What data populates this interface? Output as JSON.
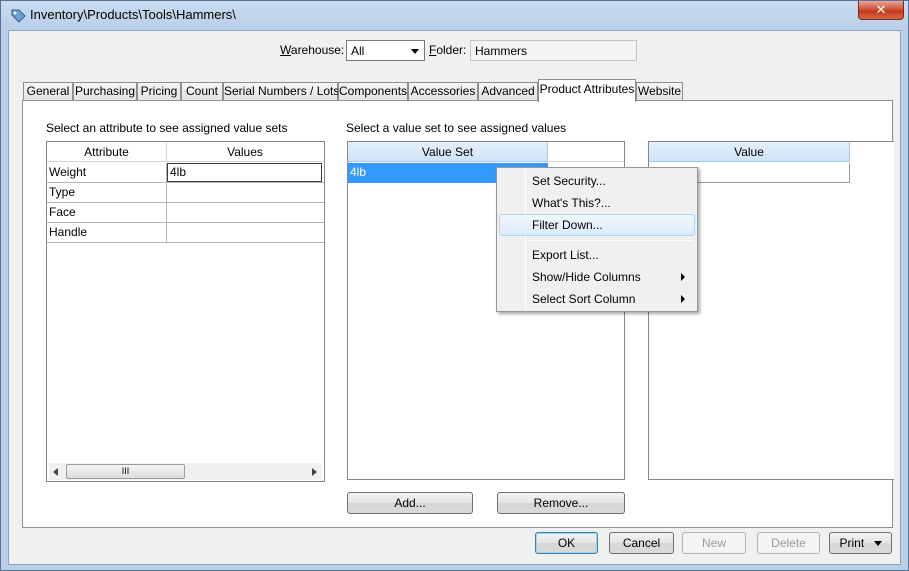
{
  "window": {
    "title": "Inventory\\Products\\Tools\\Hammers\\",
    "close_label": "✕"
  },
  "header": {
    "warehouse_label": "Warehouse:",
    "warehouse_value": "All",
    "folder_label": "Folder:",
    "folder_value": "Hammers"
  },
  "tabs": [
    "General",
    "Purchasing",
    "Pricing",
    "Count",
    "Serial Numbers / Lots",
    "Components",
    "Accessories",
    "Advanced",
    "Product Attributes",
    "Website"
  ],
  "active_tab": "Product Attributes",
  "attributes": {
    "instruction": "Select an attribute to see assigned value sets",
    "columns": [
      "Attribute",
      "Values"
    ],
    "rows": [
      {
        "attribute": "Weight",
        "values": "4lb"
      },
      {
        "attribute": "Type",
        "values": ""
      },
      {
        "attribute": "Face",
        "values": ""
      },
      {
        "attribute": "Handle",
        "values": ""
      }
    ],
    "scroll_grip": "III"
  },
  "value_sets": {
    "instruction": "Select a value set to see assigned values",
    "column": "Value Set",
    "rows": [
      "4lb"
    ]
  },
  "values_grid": {
    "column": "Value"
  },
  "panel_buttons": {
    "add": "Add...",
    "remove": "Remove..."
  },
  "context_menu": [
    "Set Security...",
    "What's This?...",
    "Filter Down...",
    "Export List...",
    "Show/Hide Columns",
    "Select Sort Column"
  ],
  "footer": {
    "ok": "OK",
    "cancel": "Cancel",
    "new": "New",
    "delete": "Delete",
    "print": "Print"
  },
  "colors": {
    "selection": "#3399ff",
    "header_blue": "#cfe3f7"
  }
}
